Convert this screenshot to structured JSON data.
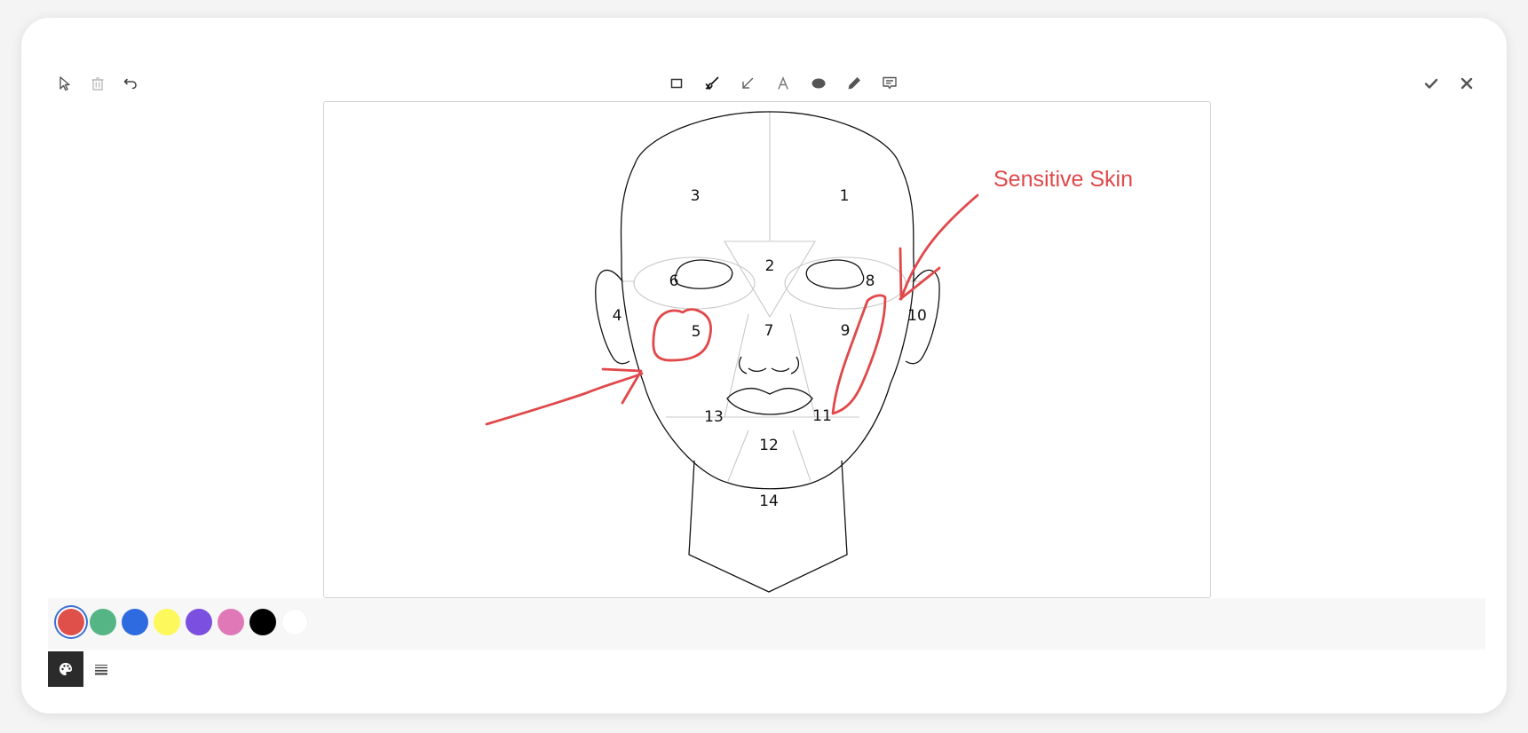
{
  "toolbar": {
    "left_tools": [
      {
        "name": "select-tool",
        "icon": "cursor-arrow-icon"
      },
      {
        "name": "delete-tool",
        "icon": "trash-icon",
        "disabled": true
      },
      {
        "name": "undo-tool",
        "icon": "undo-icon"
      }
    ],
    "center_tools": [
      {
        "name": "rectangle-tool",
        "icon": "rectangle-icon"
      },
      {
        "name": "brush-tool",
        "icon": "brush-icon",
        "active": true
      },
      {
        "name": "arrow-tool",
        "icon": "arrow-down-left-icon"
      },
      {
        "name": "text-tool",
        "icon": "text-a-icon"
      },
      {
        "name": "ellipse-tool",
        "icon": "ellipse-filled-icon"
      },
      {
        "name": "pen-tool",
        "icon": "pen-icon"
      },
      {
        "name": "comment-tool",
        "icon": "comment-icon"
      }
    ],
    "right_tools": [
      {
        "name": "confirm-button",
        "icon": "checkmark-icon"
      },
      {
        "name": "close-button",
        "icon": "close-icon"
      }
    ]
  },
  "canvas": {
    "regions": [
      {
        "id": "3",
        "label": "3"
      },
      {
        "id": "1",
        "label": "1"
      },
      {
        "id": "2",
        "label": "2"
      },
      {
        "id": "6",
        "label": "6"
      },
      {
        "id": "8",
        "label": "8"
      },
      {
        "id": "4",
        "label": "4"
      },
      {
        "id": "5",
        "label": "5"
      },
      {
        "id": "7",
        "label": "7"
      },
      {
        "id": "9",
        "label": "9"
      },
      {
        "id": "10",
        "label": "10"
      },
      {
        "id": "13",
        "label": "13"
      },
      {
        "id": "11",
        "label": "11"
      },
      {
        "id": "12",
        "label": "12"
      },
      {
        "id": "14",
        "label": "14"
      }
    ],
    "annotation_text": "Sensitive Skin",
    "annotation_color": "#e0484a"
  },
  "palette": {
    "colors": [
      "#e0504a",
      "#55b584",
      "#2f6be0",
      "#fdf85b",
      "#7b4fe0",
      "#e078b8",
      "#000000",
      "#ffffff"
    ],
    "selected_index": 0
  },
  "bottom_tabs": [
    {
      "name": "tab-colors",
      "icon": "palette-icon",
      "active": true
    },
    {
      "name": "tab-line-width",
      "icon": "lines-icon",
      "active": false
    }
  ]
}
